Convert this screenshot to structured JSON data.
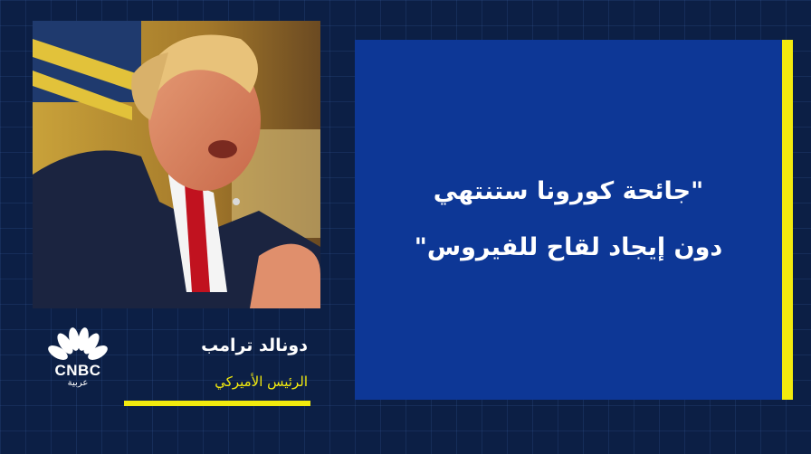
{
  "quote": {
    "line1": "\"جائحة كورونا ستنتهي",
    "line2": "دون إيجاد لقاح للفيروس\""
  },
  "person": {
    "name": "دونالد ترامب",
    "title": "الرئيس الأميركي"
  },
  "logo": {
    "word": "CNBC",
    "arabic": "عربية"
  },
  "colors": {
    "background": "#0c1f45",
    "card": "#0d3796",
    "accent": "#f2ea0e"
  }
}
